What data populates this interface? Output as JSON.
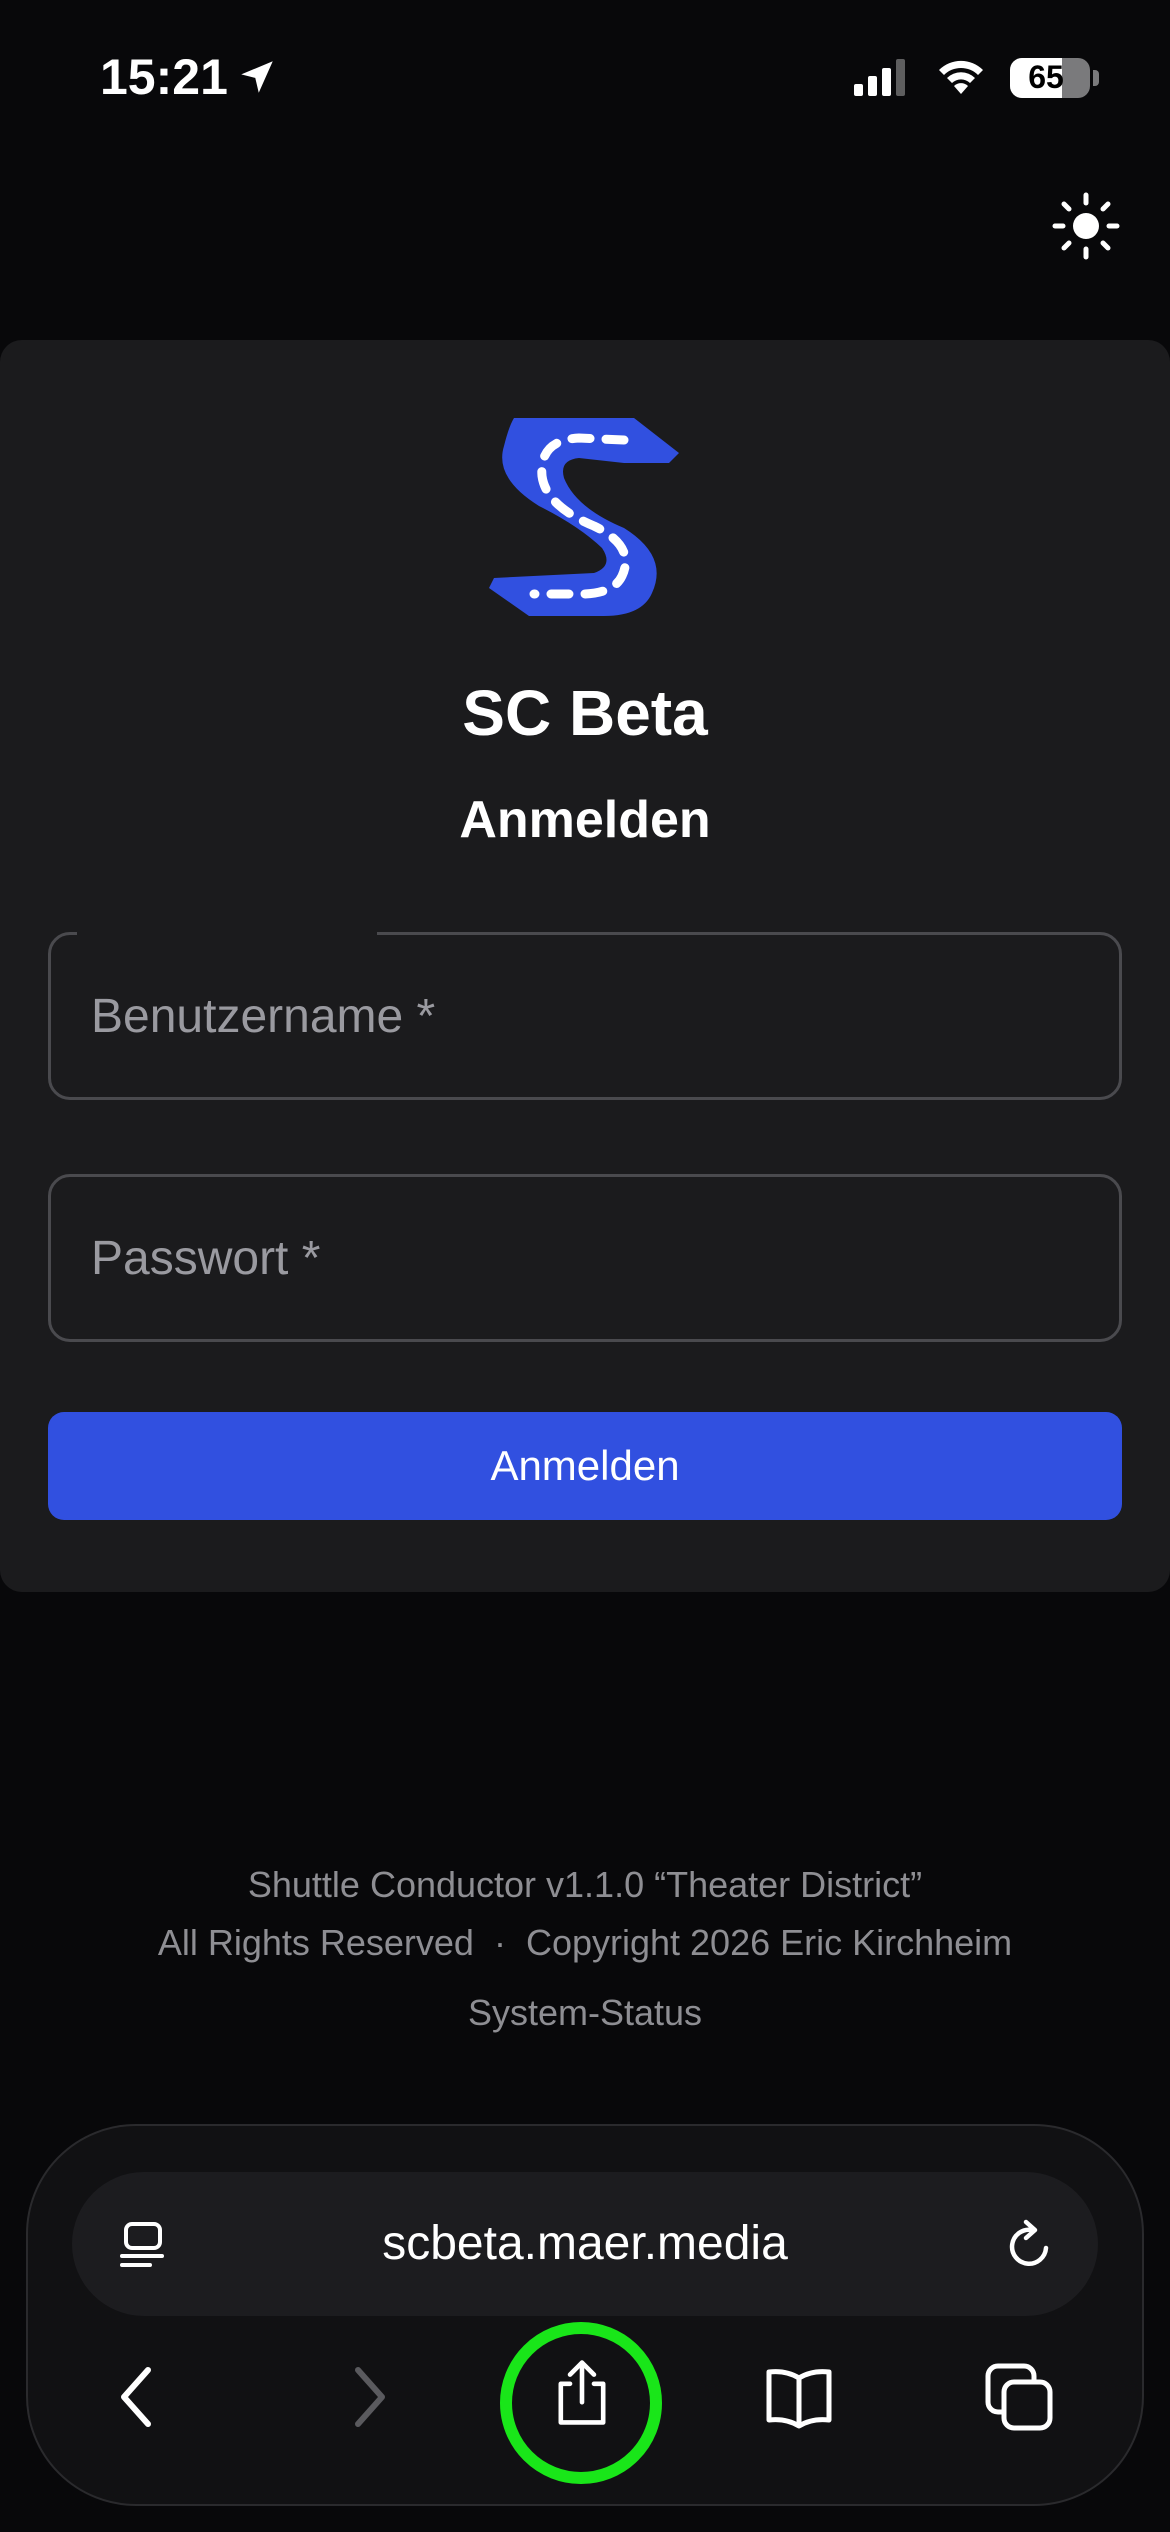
{
  "status_bar": {
    "time": "15:21",
    "battery_percent": "65",
    "battery_level": 0.65
  },
  "theme_toggle": {
    "icon": "sun-icon"
  },
  "app": {
    "title": "SC Beta",
    "logo": "road-s-logo",
    "brand_color": "#3150e0"
  },
  "login_form": {
    "heading": "Anmelden",
    "username_label": "Benutzername *",
    "password_label": "Passwort *",
    "submit_label": "Anmelden"
  },
  "footer": {
    "version_line": "Shuttle Conductor v1.1.0 “Theater District”",
    "copyright_line": "All Rights Reserved  ·  Copyright 2026 Eric Kirchheim",
    "status_link": "System-Status"
  },
  "browser": {
    "url": "scbeta.maer.media",
    "toolbar_icons": [
      "reader-icon",
      "reload-icon",
      "back-icon",
      "forward-icon",
      "share-icon",
      "bookmarks-icon",
      "tabs-icon"
    ],
    "highlight_color": "#19e619"
  }
}
